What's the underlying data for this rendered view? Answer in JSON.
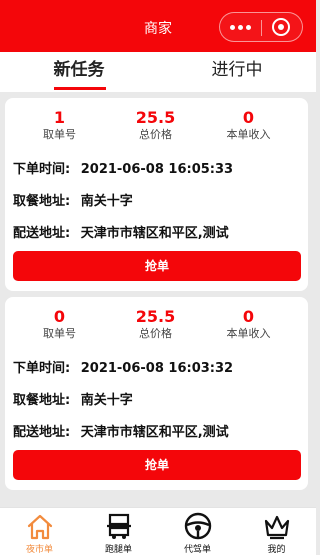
{
  "header": {
    "title": "商家"
  },
  "tabs": [
    {
      "label": "新任务",
      "active": true
    },
    {
      "label": "进行中",
      "active": false
    }
  ],
  "orders": [
    {
      "stats": [
        {
          "value": "1",
          "label": "取单号"
        },
        {
          "value": "25.5",
          "label": "总价格"
        },
        {
          "value": "0",
          "label": "本单收入"
        }
      ],
      "order_time_label": "下单时间:",
      "order_time": "2021-06-08 16:05:33",
      "pickup_label": "取餐地址:",
      "pickup": "南关十字",
      "delivery_label": "配送地址:",
      "delivery": "天津市市辖区和平区,测试",
      "action": "抢单"
    },
    {
      "stats": [
        {
          "value": "0",
          "label": "取单号"
        },
        {
          "value": "25.5",
          "label": "总价格"
        },
        {
          "value": "0",
          "label": "本单收入"
        }
      ],
      "order_time_label": "下单时间:",
      "order_time": "2021-06-08 16:03:32",
      "pickup_label": "取餐地址:",
      "pickup": "南关十字",
      "delivery_label": "配送地址:",
      "delivery": "天津市市辖区和平区,测试",
      "action": "抢单"
    }
  ],
  "bottom_nav": [
    {
      "label": "夜市单",
      "icon": "home-icon",
      "active": true
    },
    {
      "label": "跑腿单",
      "icon": "errand-icon",
      "active": false
    },
    {
      "label": "代驾单",
      "icon": "steering-wheel-icon",
      "active": false
    },
    {
      "label": "我的",
      "icon": "crown-icon",
      "active": false
    }
  ],
  "colors": {
    "brand": "#f4060a",
    "active_nav": "#f28b3d",
    "background": "#e9e9e9"
  }
}
